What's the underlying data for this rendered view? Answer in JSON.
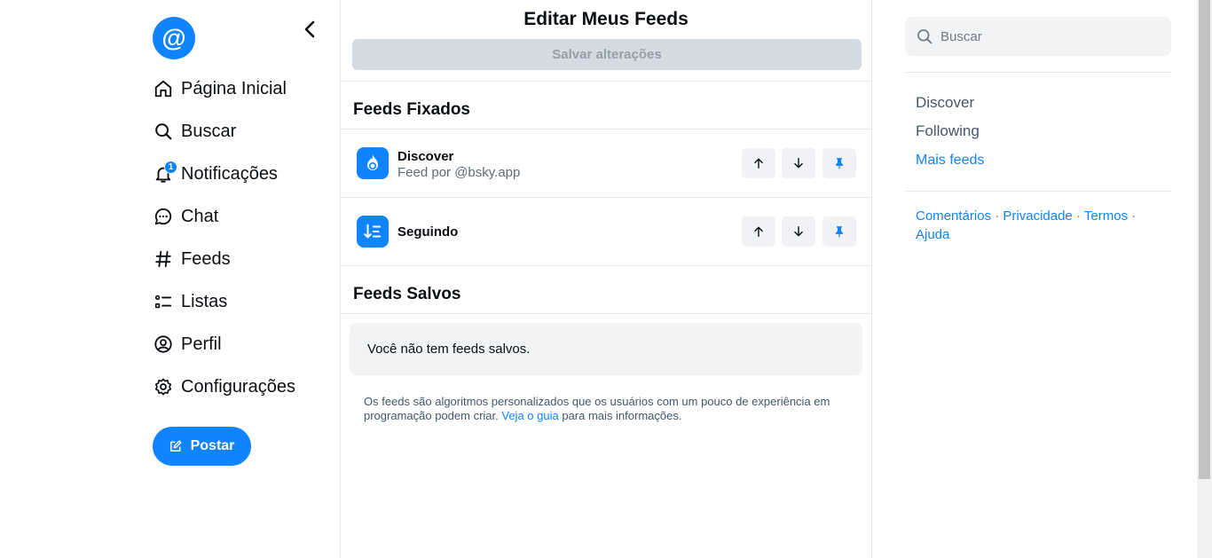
{
  "nav": {
    "avatar_symbol": "@",
    "items": [
      {
        "label": "Página Inicial",
        "icon": "home-icon"
      },
      {
        "label": "Buscar",
        "icon": "search-icon"
      },
      {
        "label": "Notificações",
        "icon": "bell-icon",
        "badge": "1"
      },
      {
        "label": "Chat",
        "icon": "chat-icon"
      },
      {
        "label": "Feeds",
        "icon": "hash-icon"
      },
      {
        "label": "Listas",
        "icon": "list-icon"
      },
      {
        "label": "Perfil",
        "icon": "profile-icon"
      },
      {
        "label": "Configurações",
        "icon": "gear-icon"
      }
    ],
    "post_label": "Postar"
  },
  "main": {
    "title": "Editar Meus Feeds",
    "save_label": "Salvar alterações",
    "pinned_title": "Feeds Fixados",
    "pinned_feeds": [
      {
        "name": "Discover",
        "subtitle": "Feed por @bsky.app"
      },
      {
        "name": "Seguindo",
        "subtitle": ""
      }
    ],
    "saved_title": "Feeds Salvos",
    "saved_empty": "Você não tem feeds salvos.",
    "info_text_before": "Os feeds são algoritmos personalizados que os usuários com um pouco de experiência em programação podem criar.",
    "info_link": "Veja o guia",
    "info_text_after": "para mais informações."
  },
  "right": {
    "search_placeholder": "Buscar",
    "feeds": [
      {
        "label": "Discover"
      },
      {
        "label": "Following"
      },
      {
        "label": "Mais feeds"
      }
    ],
    "footer": {
      "comments": "Comentários",
      "privacy": "Privacidade",
      "terms": "Termos",
      "help": "Ajuda",
      "separator": "·"
    }
  },
  "colors": {
    "accent": "#1083fe",
    "disabled_button": "#d4dbe2",
    "muted_text": "#5d6b78"
  }
}
